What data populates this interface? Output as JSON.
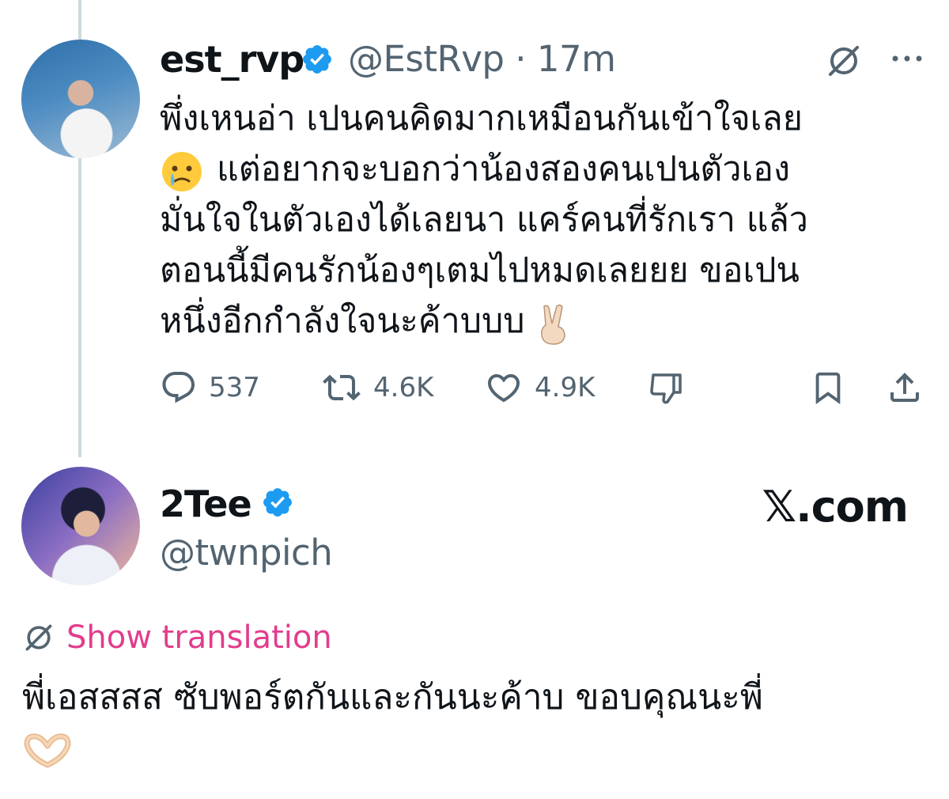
{
  "tweet": {
    "display_name": "est_rvp",
    "handle_time": "@EstRvp · 17m",
    "body_lines": [
      "พึ่งเหนอ่า เปนคนคิดมากเหมือนกันเข้าใจเลย",
      "แต่อยากจะบอกว่าน้องสองคนเปนตัวเอง",
      "มั่นใจในตัวเองได้เลยนา แคร์คนที่รักเรา แล้ว",
      "ตอนนี้มีคนรักน้องๆเตมไปหมดเลยยย ขอเปน",
      "หนึ่งอีกกำลังใจนะค้าบบบ"
    ],
    "reply_count": "537",
    "repost_count": "4.6K",
    "like_count": "4.9K"
  },
  "reply": {
    "display_name": "2Tee",
    "handle": "@twnpich",
    "brand": "𝕏.com",
    "show_translation": "Show translation",
    "text": "พี่เอสสสส ซับพอร์ตกันและกันนะค้าบ ขอบคุณนะพี่"
  },
  "colors": {
    "verified": "#1d9bf0",
    "muted": "#536471",
    "translation_link": "#e23d8c",
    "thread_line": "#cfd9de"
  },
  "icons": {
    "verified": "verified-badge-icon",
    "grok": "grok-icon",
    "more": "more-icon",
    "reply": "reply-icon",
    "repost": "repost-icon",
    "like": "heart-icon",
    "dislike": "dislike-icon",
    "bookmark": "bookmark-icon",
    "share": "share-icon",
    "translate": "translate-icon"
  }
}
